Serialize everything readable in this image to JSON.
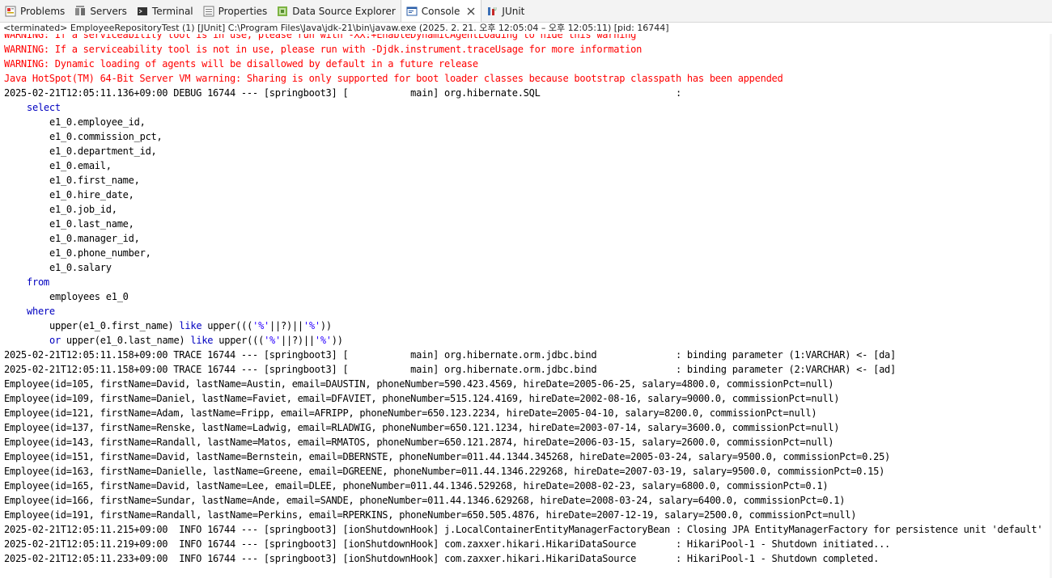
{
  "tabs": [
    {
      "label": "Problems",
      "icon": "problems-icon"
    },
    {
      "label": "Servers",
      "icon": "servers-icon"
    },
    {
      "label": "Terminal",
      "icon": "terminal-icon"
    },
    {
      "label": "Properties",
      "icon": "properties-icon"
    },
    {
      "label": "Data Source Explorer",
      "icon": "data-source-explorer-icon"
    },
    {
      "label": "Console",
      "icon": "console-icon",
      "active": true
    },
    {
      "label": "JUnit",
      "icon": "junit-icon"
    }
  ],
  "console": {
    "header": "<terminated> EmployeeRepositoryTest (1) [JUnit] C:\\Program Files\\Java\\jdk-21\\bin\\javaw.exe  (2025. 2. 21. 오후 12:05:04 – 오후 12:05:11) [pid: 16744]",
    "lines": [
      {
        "text": "WARNING: If a serviceability tool is in use, please run with -XX:+EnableDynamicAgentLoading to hide this warning",
        "style": "err"
      },
      {
        "text": "WARNING: If a serviceability tool is not in use, please run with -Djdk.instrument.traceUsage for more information",
        "style": "err"
      },
      {
        "text": "WARNING: Dynamic loading of agents will be disallowed by default in a future release",
        "style": "err"
      },
      {
        "text": "Java HotSpot(TM) 64-Bit Server VM warning: Sharing is only supported for boot loader classes because bootstrap classpath has been appended",
        "style": "err"
      },
      {
        "text": "2025-02-21T12:05:11.136+09:00 DEBUG 16744 --- [springboot3] [           main] org.hibernate.SQL                        : ",
        "style": "log"
      },
      {
        "text": "select",
        "style": "kw1"
      },
      {
        "text": "e1_0.employee_id,",
        "style": "ind2"
      },
      {
        "text": "e1_0.commission_pct,",
        "style": "ind2"
      },
      {
        "text": "e1_0.department_id,",
        "style": "ind2"
      },
      {
        "text": "e1_0.email,",
        "style": "ind2"
      },
      {
        "text": "e1_0.first_name,",
        "style": "ind2"
      },
      {
        "text": "e1_0.hire_date,",
        "style": "ind2"
      },
      {
        "text": "e1_0.job_id,",
        "style": "ind2"
      },
      {
        "text": "e1_0.last_name,",
        "style": "ind2"
      },
      {
        "text": "e1_0.manager_id,",
        "style": "ind2"
      },
      {
        "text": "e1_0.phone_number,",
        "style": "ind2"
      },
      {
        "text": "e1_0.salary",
        "style": "ind2"
      },
      {
        "text": "from",
        "style": "kw1"
      },
      {
        "text": "employees e1_0",
        "style": "ind2"
      },
      {
        "text": "where",
        "style": "kw1"
      },
      {
        "text": "upper(e1_0.first_name) like upper((('%'||?)||'%'))",
        "style": "where1"
      },
      {
        "text": "or upper(e1_0.last_name) like upper((('%'||?)||'%'))",
        "style": "where2"
      },
      {
        "text": "2025-02-21T12:05:11.158+09:00 TRACE 16744 --- [springboot3] [           main] org.hibernate.orm.jdbc.bind              : binding parameter (1:VARCHAR) <- [da]",
        "style": "log"
      },
      {
        "text": "2025-02-21T12:05:11.158+09:00 TRACE 16744 --- [springboot3] [           main] org.hibernate.orm.jdbc.bind              : binding parameter (2:VARCHAR) <- [ad]",
        "style": "log"
      },
      {
        "text": "Employee(id=105, firstName=David, lastName=Austin, email=DAUSTIN, phoneNumber=590.423.4569, hireDate=2005-06-25, salary=4800.0, commissionPct=null)",
        "style": "log"
      },
      {
        "text": "Employee(id=109, firstName=Daniel, lastName=Faviet, email=DFAVIET, phoneNumber=515.124.4169, hireDate=2002-08-16, salary=9000.0, commissionPct=null)",
        "style": "log"
      },
      {
        "text": "Employee(id=121, firstName=Adam, lastName=Fripp, email=AFRIPP, phoneNumber=650.123.2234, hireDate=2005-04-10, salary=8200.0, commissionPct=null)",
        "style": "log"
      },
      {
        "text": "Employee(id=137, firstName=Renske, lastName=Ladwig, email=RLADWIG, phoneNumber=650.121.1234, hireDate=2003-07-14, salary=3600.0, commissionPct=null)",
        "style": "log"
      },
      {
        "text": "Employee(id=143, firstName=Randall, lastName=Matos, email=RMATOS, phoneNumber=650.121.2874, hireDate=2006-03-15, salary=2600.0, commissionPct=null)",
        "style": "log"
      },
      {
        "text": "Employee(id=151, firstName=David, lastName=Bernstein, email=DBERNSTE, phoneNumber=011.44.1344.345268, hireDate=2005-03-24, salary=9500.0, commissionPct=0.25)",
        "style": "log"
      },
      {
        "text": "Employee(id=163, firstName=Danielle, lastName=Greene, email=DGREENE, phoneNumber=011.44.1346.229268, hireDate=2007-03-19, salary=9500.0, commissionPct=0.15)",
        "style": "log"
      },
      {
        "text": "Employee(id=165, firstName=David, lastName=Lee, email=DLEE, phoneNumber=011.44.1346.529268, hireDate=2008-02-23, salary=6800.0, commissionPct=0.1)",
        "style": "log"
      },
      {
        "text": "Employee(id=166, firstName=Sundar, lastName=Ande, email=SANDE, phoneNumber=011.44.1346.629268, hireDate=2008-03-24, salary=6400.0, commissionPct=0.1)",
        "style": "log"
      },
      {
        "text": "Employee(id=191, firstName=Randall, lastName=Perkins, email=RPERKINS, phoneNumber=650.505.4876, hireDate=2007-12-19, salary=2500.0, commissionPct=null)",
        "style": "log"
      },
      {
        "text": "2025-02-21T12:05:11.215+09:00  INFO 16744 --- [springboot3] [ionShutdownHook] j.LocalContainerEntityManagerFactoryBean : Closing JPA EntityManagerFactory for persistence unit 'default'",
        "style": "log"
      },
      {
        "text": "2025-02-21T12:05:11.219+09:00  INFO 16744 --- [springboot3] [ionShutdownHook] com.zaxxer.hikari.HikariDataSource       : HikariPool-1 - Shutdown initiated...",
        "style": "log"
      },
      {
        "text": "2025-02-21T12:05:11.233+09:00  INFO 16744 --- [springboot3] [ionShutdownHook] com.zaxxer.hikari.HikariDataSource       : HikariPool-1 - Shutdown completed.",
        "style": "log"
      }
    ]
  },
  "colors": {
    "error_text": "#ff0000",
    "sql_keyword": "#0000c0",
    "tab_bar_bg": "#f3f3f3"
  }
}
